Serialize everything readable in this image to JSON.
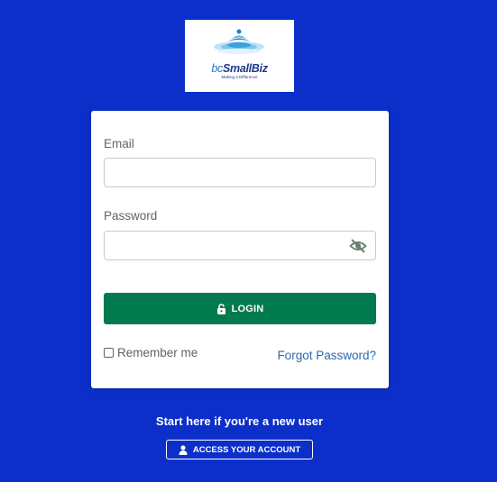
{
  "logo": {
    "brand_prefix": "bc",
    "brand_name": "SmallBiz",
    "tagline": "Making a Difference"
  },
  "login_form": {
    "email_label": "Email",
    "email_value": "",
    "password_label": "Password",
    "password_value": "",
    "password_toggle_icon": "eye-slash-icon",
    "login_button_icon": "unlock-icon",
    "login_button_label": "LOGIN",
    "remember_me_label": "Remember me",
    "remember_me_checked": false,
    "forgot_password_label": "Forgot Password?"
  },
  "signup": {
    "prompt": "Start here if you're a new user",
    "button_icon": "user-icon",
    "button_label": "ACCESS YOUR ACCOUNT"
  },
  "colors": {
    "background": "#0c2fc9",
    "login_button": "#007a4e",
    "link": "#2a6bb0"
  }
}
